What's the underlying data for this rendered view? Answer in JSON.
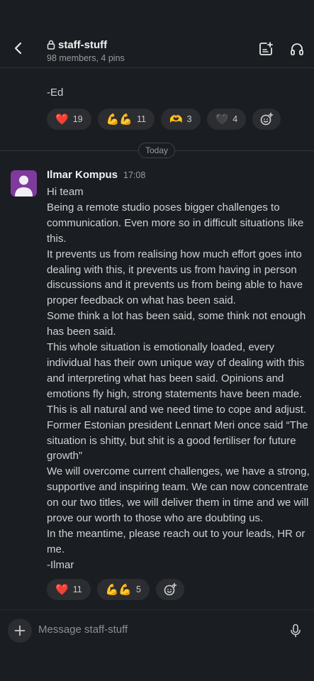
{
  "header": {
    "channel_name": "staff-stuff",
    "meta": "98 members, 4 pins"
  },
  "previous_message": {
    "text": "-Ed",
    "reactions": [
      {
        "emoji": "❤️",
        "count": "19"
      },
      {
        "emoji": "💪💪",
        "count": "11"
      },
      {
        "emoji": "🫶",
        "count": "3"
      },
      {
        "emoji": "🖤",
        "count": "4"
      }
    ]
  },
  "date_divider": "Today",
  "message": {
    "author": "Ilmar Kompus",
    "time": "17:08",
    "lines": [
      "Hi team",
      "Being a remote studio poses bigger challenges to",
      "communication. Even more so in difficult situations like",
      "this.",
      "It prevents us from realising how much effort goes into",
      "dealing with this, it prevents us from having in person",
      "discussions and it prevents us from being able to have",
      "proper feedback on what has been said.",
      "Some think a lot has been said, some think not enough",
      "has been said.",
      "This whole situation is emotionally loaded, every",
      "individual has their own unique way of dealing with this",
      "and interpreting what has been said. Opinions and",
      "emotions fly high, strong statements have been made.",
      "This is all natural and we need time to cope and adjust.",
      "Former Estonian president Lennart Meri once said “The",
      "situation is shitty, but shit is a good fertiliser for future",
      "growth”",
      "We will overcome current challenges, we have a strong,",
      "supportive and inspiring team.  We can now concentrate",
      "on our two titles, we will deliver them in time and we will",
      "prove our worth to those who are doubting us.",
      "In the meantime, please reach out to your leads, HR or",
      "me.",
      "-Ilmar"
    ],
    "reactions": [
      {
        "emoji": "❤️",
        "count": "11"
      },
      {
        "emoji": "💪💪",
        "count": "5"
      }
    ]
  },
  "composer": {
    "placeholder": "Message staff-stuff"
  },
  "colors": {
    "background": "#1a1d21",
    "reaction_bg": "#2b2d31",
    "avatar_bg": "#7f3a9c"
  },
  "icons": [
    "chevron-left-icon",
    "lock-icon",
    "canvas-icon",
    "headphones-icon",
    "add-reaction-icon",
    "plus-icon",
    "microphone-icon"
  ]
}
